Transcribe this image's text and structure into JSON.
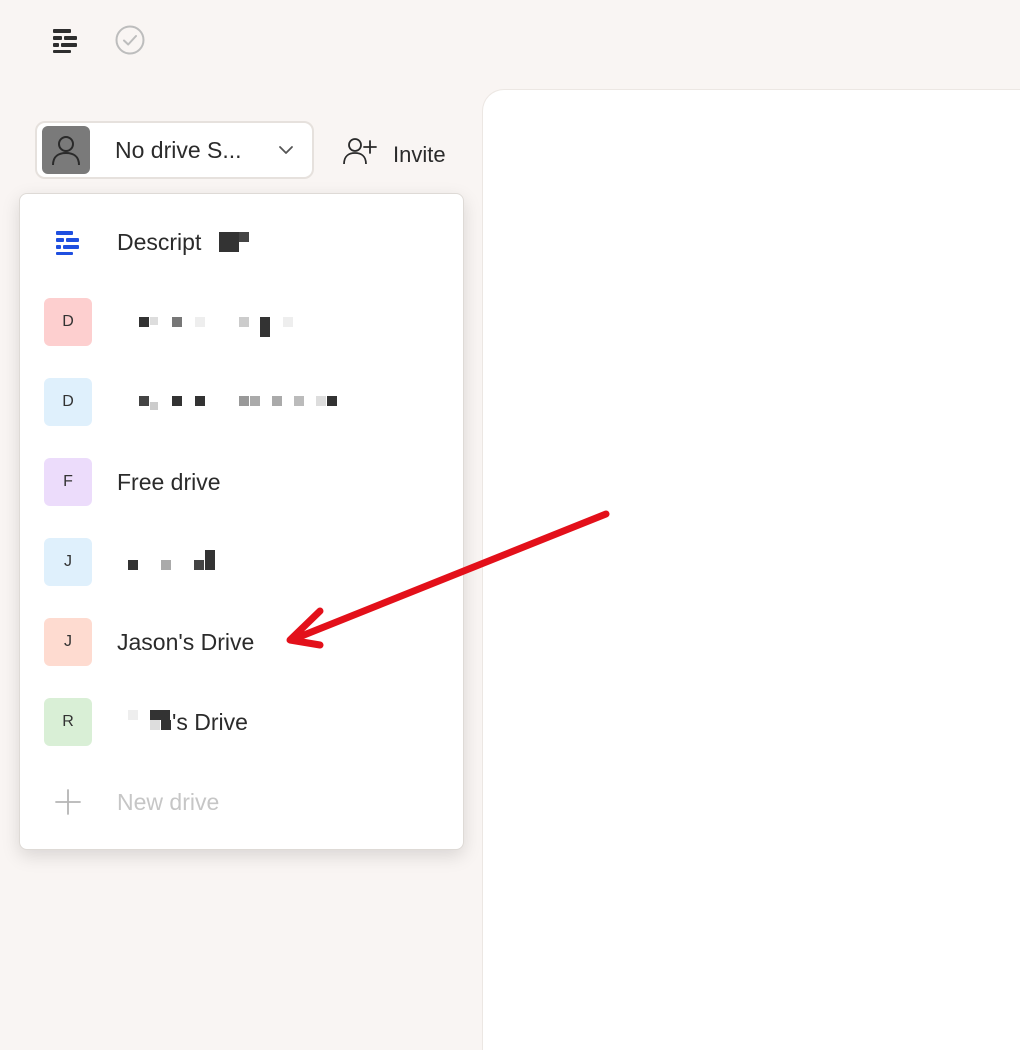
{
  "topbar": {
    "logo_icon": "descript-logo-icon",
    "status_icon": "check-circle-icon"
  },
  "drive_selector": {
    "label": "No drive S...",
    "avatar_icon": "person-icon",
    "chevron_icon": "chevron-down-icon"
  },
  "invite": {
    "label": "Invite",
    "icon": "add-user-icon"
  },
  "menu": {
    "items": [
      {
        "badge": "",
        "name": "Descript",
        "badge_color": ""
      },
      {
        "badge": "D",
        "name": "",
        "badge_color": "#fdcfcf"
      },
      {
        "badge": "D",
        "name": "",
        "badge_color": "#dff0fc"
      },
      {
        "badge": "F",
        "name": "Free drive",
        "badge_color": "#ecdcfb"
      },
      {
        "badge": "J",
        "name": "",
        "badge_color": "#dff0fc"
      },
      {
        "badge": "J",
        "name": "Jason's Drive",
        "badge_color": "#fedbd0"
      },
      {
        "badge": "R",
        "name": "'s Drive",
        "badge_color": "#d9efd6"
      },
      {
        "badge": "",
        "name": "New drive",
        "badge_color": ""
      }
    ]
  },
  "annotation": {
    "arrow_color": "#e3101a"
  }
}
